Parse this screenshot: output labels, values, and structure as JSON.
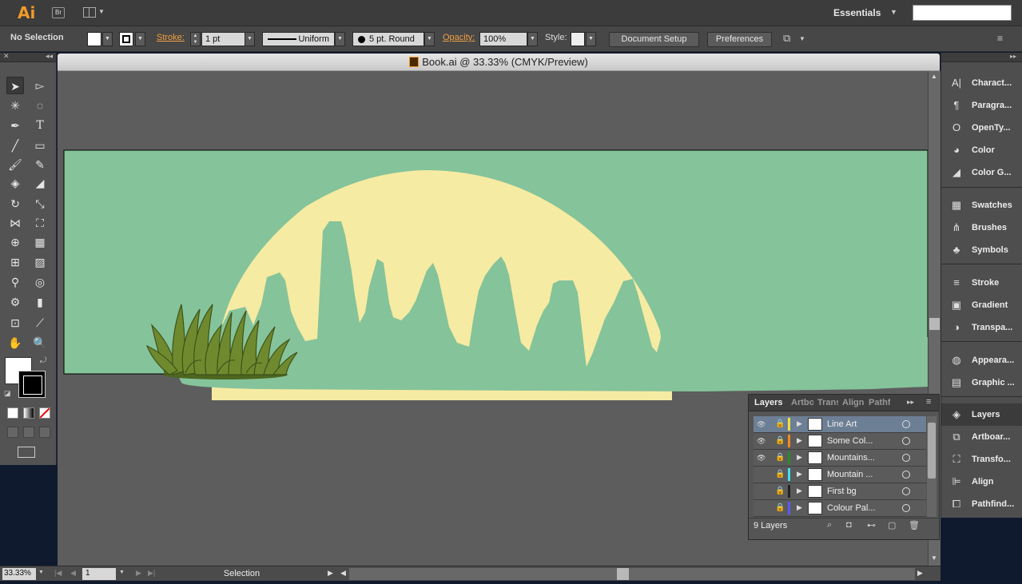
{
  "app": {
    "logo": "Ai",
    "bridge_label": "Br",
    "workspace": "Essentials",
    "search_placeholder": ""
  },
  "control_bar": {
    "selection_status": "No Selection",
    "stroke_label": "Stroke:",
    "stroke_weight": "1 pt",
    "stroke_profile": "Uniform",
    "brush": "5 pt. Round",
    "opacity_label": "Opacity:",
    "opacity_value": "100%",
    "style_label": "Style:",
    "document_setup": "Document Setup",
    "preferences": "Preferences"
  },
  "document": {
    "tab_title": "Book.ai @ 33.33% (CMYK/Preview)"
  },
  "artwork": {
    "background": "#85c39a",
    "sun": "#f6eba2",
    "grass": "#6f8a2e",
    "grass_dark": "#4d6620"
  },
  "status_bar": {
    "zoom": "33.33%",
    "page": "1",
    "mode": "Selection"
  },
  "dock": {
    "group1": [
      "Charact...",
      "Paragra...",
      "OpenTy...",
      "Color",
      "Color G..."
    ],
    "group2": [
      "Swatches",
      "Brushes",
      "Symbols"
    ],
    "group3": [
      "Stroke",
      "Gradient",
      "Transpa..."
    ],
    "group4": [
      "Appeara...",
      "Graphic ..."
    ],
    "group5": [
      "Layers",
      "Artboar...",
      "Transfo...",
      "Align",
      "Pathfind..."
    ]
  },
  "layers_panel": {
    "tabs": [
      "Layers",
      "Artbo",
      "Trans",
      "Align",
      "Pathf"
    ],
    "rows": [
      {
        "name": "Line Art",
        "color": "#f0e040",
        "visible": true
      },
      {
        "name": "Some Col...",
        "color": "#f08a20",
        "visible": true
      },
      {
        "name": "Mountains...",
        "color": "#2a8a2a",
        "visible": true
      },
      {
        "name": "Mountain ...",
        "color": "#40e0f0",
        "visible": false
      },
      {
        "name": "First bg",
        "color": "#222222",
        "visible": false
      },
      {
        "name": "Colour Pal...",
        "color": "#5a5af0",
        "visible": false
      }
    ],
    "count": "9 Layers"
  }
}
